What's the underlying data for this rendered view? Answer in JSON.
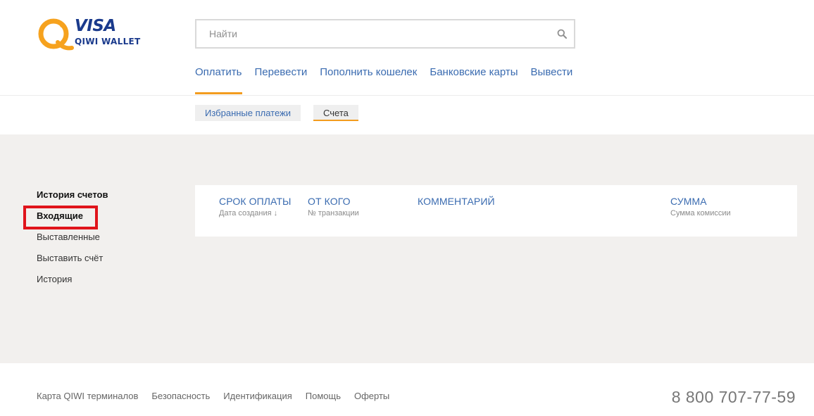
{
  "logo": {
    "brand": "VISA",
    "product": "QIWI WALLET"
  },
  "search": {
    "placeholder": "Найти",
    "icon": "search-icon"
  },
  "main_nav": [
    {
      "label": "Оплатить",
      "active": true
    },
    {
      "label": "Перевести",
      "active": false
    },
    {
      "label": "Пополнить кошелек",
      "active": false
    },
    {
      "label": "Банковские карты",
      "active": false
    },
    {
      "label": "Вывести",
      "active": false
    }
  ],
  "sub_nav": [
    {
      "label": "Избранные платежи",
      "active": false
    },
    {
      "label": "Счета",
      "active": true
    }
  ],
  "side_menu": {
    "heading": "История счетов",
    "items": [
      "Входящие",
      "Выставленные",
      "Выставить счёт",
      "История"
    ],
    "selected": "Входящие"
  },
  "table": {
    "columns": [
      {
        "title": "СРОК ОПЛАТЫ",
        "subtitle": "Дата создания ↓"
      },
      {
        "title": "ОТ КОГО",
        "subtitle": "№ транзакции"
      },
      {
        "title": "КОММЕНТАРИЙ",
        "subtitle": ""
      },
      {
        "title": "СУММА",
        "subtitle": "Сумма комиссии"
      }
    ]
  },
  "footer": {
    "links": [
      "Карта QIWI терминалов",
      "Безопасность",
      "Идентификация",
      "Помощь",
      "Оферты"
    ],
    "phone": "8 800 707-77-59"
  },
  "colors": {
    "accent": "#f39c1f",
    "link": "#3a6bb0",
    "brand_blue": "#1a3a8c",
    "highlight": "#e0141b",
    "band": "#f2f0ee"
  }
}
